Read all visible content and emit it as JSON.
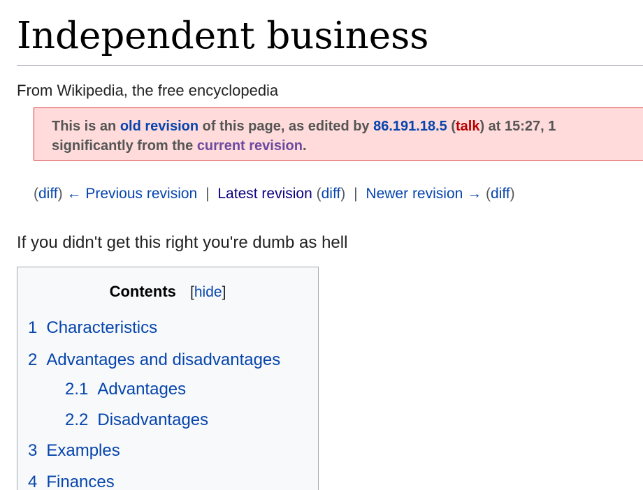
{
  "title": "Independent business",
  "tagline": "From Wikipedia, the free encyclopedia",
  "revision_notice": {
    "part1": "This is an ",
    "old_revision": "old revision",
    "part2": " of this page, as edited by ",
    "editor": "86.191.18.5",
    "part3": " (",
    "talk": "talk",
    "part4": ") at 15:27, 1",
    "part5": "significantly from the ",
    "current_revision": "current revision",
    "part6": "."
  },
  "revision_nav": {
    "diff_label": "diff",
    "previous_revision": "← Previous revision",
    "latest_revision": "Latest revision",
    "newer_revision": "Newer revision →",
    "separator": "|",
    "open_paren": "(",
    "close_paren": ")"
  },
  "lead_text": "If you didn't get this right you're dumb as hell",
  "toc": {
    "heading": "Contents",
    "toggle_open": "[",
    "toggle_label": "hide",
    "toggle_close": "]",
    "items": [
      {
        "number": "1",
        "label": "Characteristics"
      },
      {
        "number": "2",
        "label": "Advantages and disadvantages"
      },
      {
        "number": "2.1",
        "label": "Advantages"
      },
      {
        "number": "2.2",
        "label": "Disadvantages"
      },
      {
        "number": "3",
        "label": "Examples"
      },
      {
        "number": "4",
        "label": "Finances"
      }
    ]
  }
}
